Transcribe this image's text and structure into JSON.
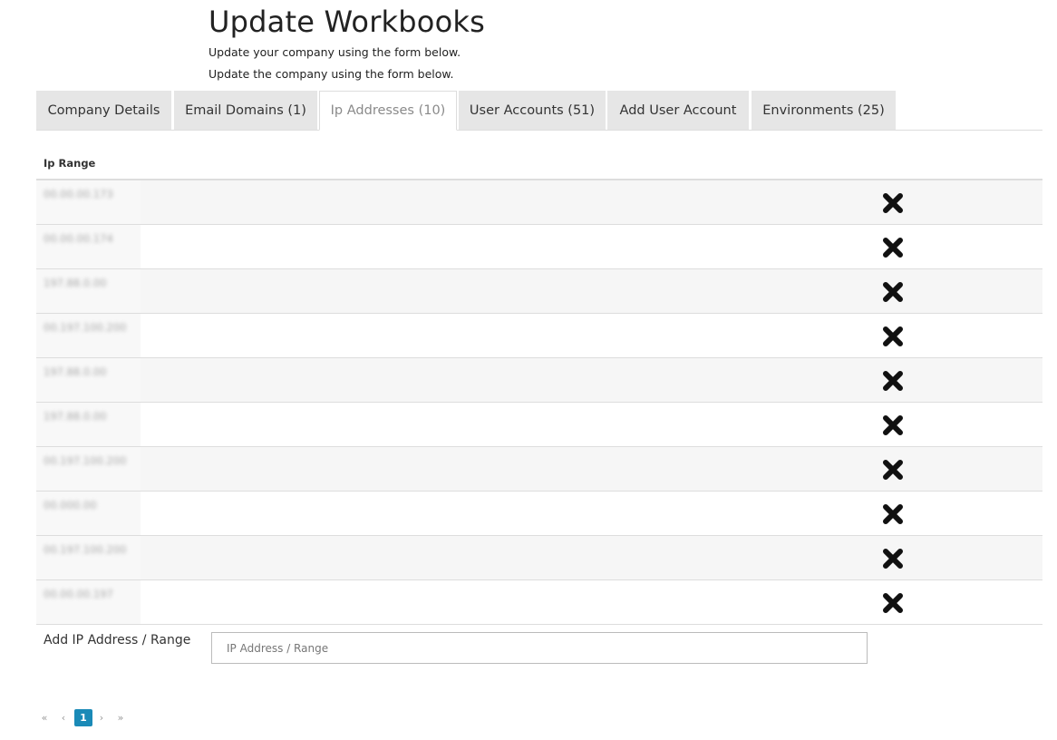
{
  "page": {
    "title": "Update Workbooks",
    "subtitle_1": "Update your company using the form below.",
    "subtitle_2": "Update the company using the form below."
  },
  "tabs": [
    {
      "label": "Company Details",
      "active": false
    },
    {
      "label": "Email Domains (1)",
      "active": false
    },
    {
      "label": "Ip Addresses (10)",
      "active": true
    },
    {
      "label": "User Accounts (51)",
      "active": false
    },
    {
      "label": "Add User Account",
      "active": false
    },
    {
      "label": "Environments (25)",
      "active": false
    }
  ],
  "table": {
    "column_header": "Ip Range",
    "rows": [
      {
        "ip": "00.00.00.173"
      },
      {
        "ip": "00.00.00.174"
      },
      {
        "ip": "197.88.0.00"
      },
      {
        "ip": "00.197.100.200"
      },
      {
        "ip": "197.88.0.00"
      },
      {
        "ip": "197.88.0.00"
      },
      {
        "ip": "00.197.100.200"
      },
      {
        "ip": "00.000.00"
      },
      {
        "ip": "00.197.100.200"
      },
      {
        "ip": "00.00.00.197"
      }
    ],
    "delete_icon": "close-x-icon"
  },
  "add_ip": {
    "label": "Add IP Address / Range",
    "placeholder": "IP Address / Range",
    "value": ""
  },
  "pagination": {
    "first": "«",
    "prev": "‹",
    "current": "1",
    "next": "›",
    "last": "»"
  },
  "colors": {
    "accent": "#1a8ab7",
    "tab_inactive_bg": "#e6e6e6",
    "row_alt_bg": "#f6f6f6",
    "border": "#dddddd"
  }
}
